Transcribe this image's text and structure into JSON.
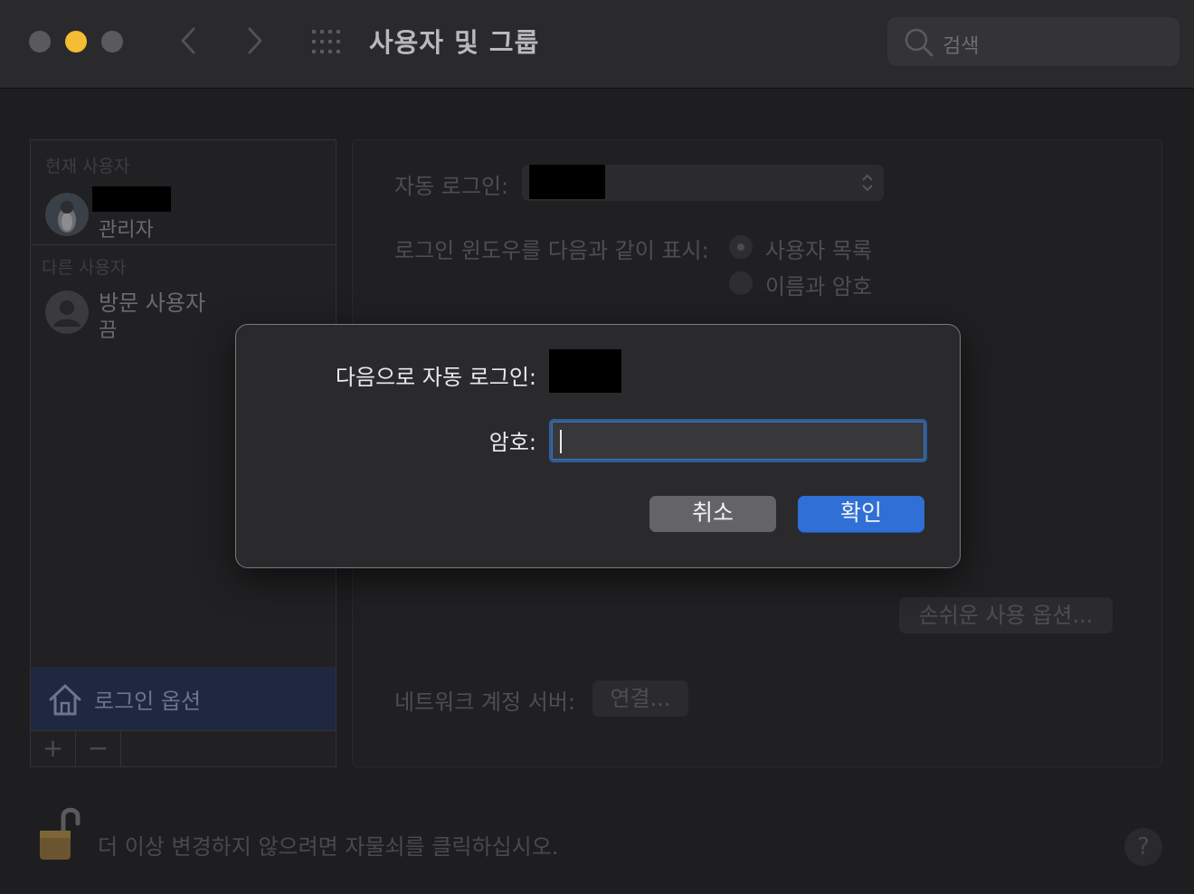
{
  "titlebar": {
    "title": "사용자 및 그룹",
    "search_placeholder": "검색",
    "colors": {
      "minimize": "#f5bd33",
      "inactive": "#5a5a5c"
    }
  },
  "sidebar": {
    "current_users_header": "현재 사용자",
    "current_user": {
      "name": "",
      "role": "관리자"
    },
    "other_users_header": "다른 사용자",
    "other_user": {
      "name": "방문 사용자",
      "status": "끔"
    },
    "selected_item": {
      "label": "로그인 옵션",
      "icon": "home-icon"
    },
    "add_button": "+",
    "remove_button": "−"
  },
  "panel": {
    "auto_login_label": "자동 로그인:",
    "login_window_label": "로그인 윈도우를 다음과 같이 표시:",
    "radio_user_list": "사용자 목록",
    "radio_name_password": "이름과 암호",
    "accessibility_button": "손쉬운 사용 옵션...",
    "network_server_label": "네트워크 계정 서버:",
    "connect_button": "연결..."
  },
  "footer": {
    "lock_text": "더 이상 변경하지 않으려면 자물쇠를 클릭하십시오.",
    "help": "?"
  },
  "dialog": {
    "auto_login_as_label": "다음으로 자동 로그인:",
    "password_label": "암호:",
    "password_value": "",
    "cancel_label": "취소",
    "ok_label": "확인",
    "accent_color": "#2f6fd6"
  }
}
